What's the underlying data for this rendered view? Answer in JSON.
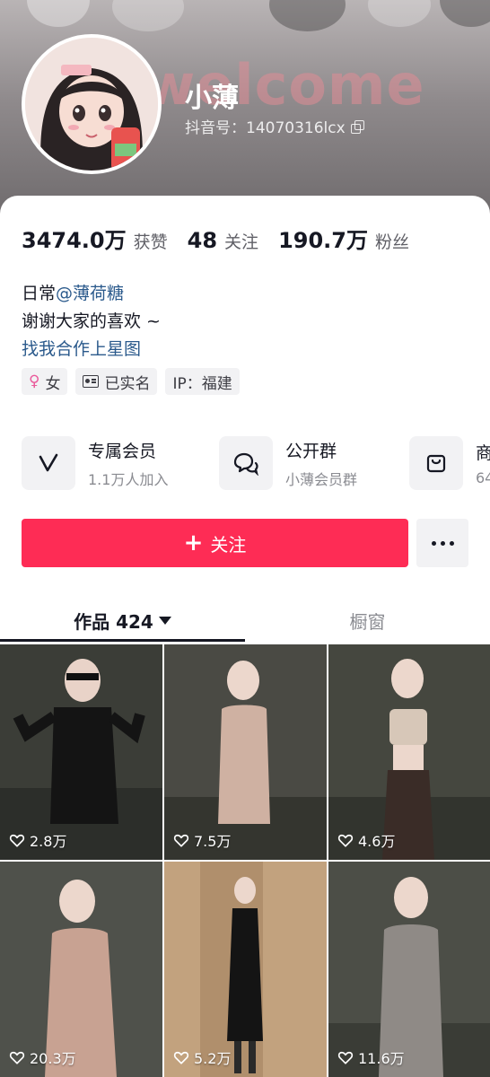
{
  "profile": {
    "username": "小薄",
    "douyin_id": "抖音号：14070316lcx",
    "banner_text": "welcome"
  },
  "stats": [
    {
      "value": "3474.0万",
      "label": "获赞"
    },
    {
      "value": "48",
      "label": "关注"
    },
    {
      "value": "190.7万",
      "label": "粉丝"
    }
  ],
  "bio": {
    "line1_prefix": "日常",
    "line1_mention": "@薄荷糖",
    "line2": "谢谢大家的喜欢 ~",
    "line3_link": "找我合作上星图"
  },
  "tags": {
    "gender": "女",
    "verified": "已实名",
    "ip": "IP：福建"
  },
  "features": [
    {
      "icon": "v-icon",
      "title": "专属会员",
      "subtitle": "1.1万人加入"
    },
    {
      "icon": "chat-bubble-icon",
      "title": "公开群",
      "subtitle": "小薄会员群"
    },
    {
      "icon": "shopping-bag-icon",
      "title": "商",
      "subtitle": "64"
    }
  ],
  "actions": {
    "follow_plus": "+",
    "follow_label": "关注"
  },
  "tabs": {
    "works_label": "作品 424",
    "window_label": "橱窗"
  },
  "posts": [
    {
      "likes": "2.8万",
      "bg": "#3b3d37"
    },
    {
      "likes": "7.5万",
      "bg": "#4a4a44"
    },
    {
      "likes": "4.6万",
      "bg": "#45473f"
    },
    {
      "likes": "20.3万",
      "bg": "#4f514b"
    },
    {
      "likes": "5.2万",
      "bg": "#c2a27e"
    },
    {
      "likes": "11.6万",
      "bg": "#4c4e47"
    }
  ],
  "colors": {
    "accent": "#fe2c55",
    "link": "#2b5a8c",
    "muted": "#8a8b91"
  }
}
